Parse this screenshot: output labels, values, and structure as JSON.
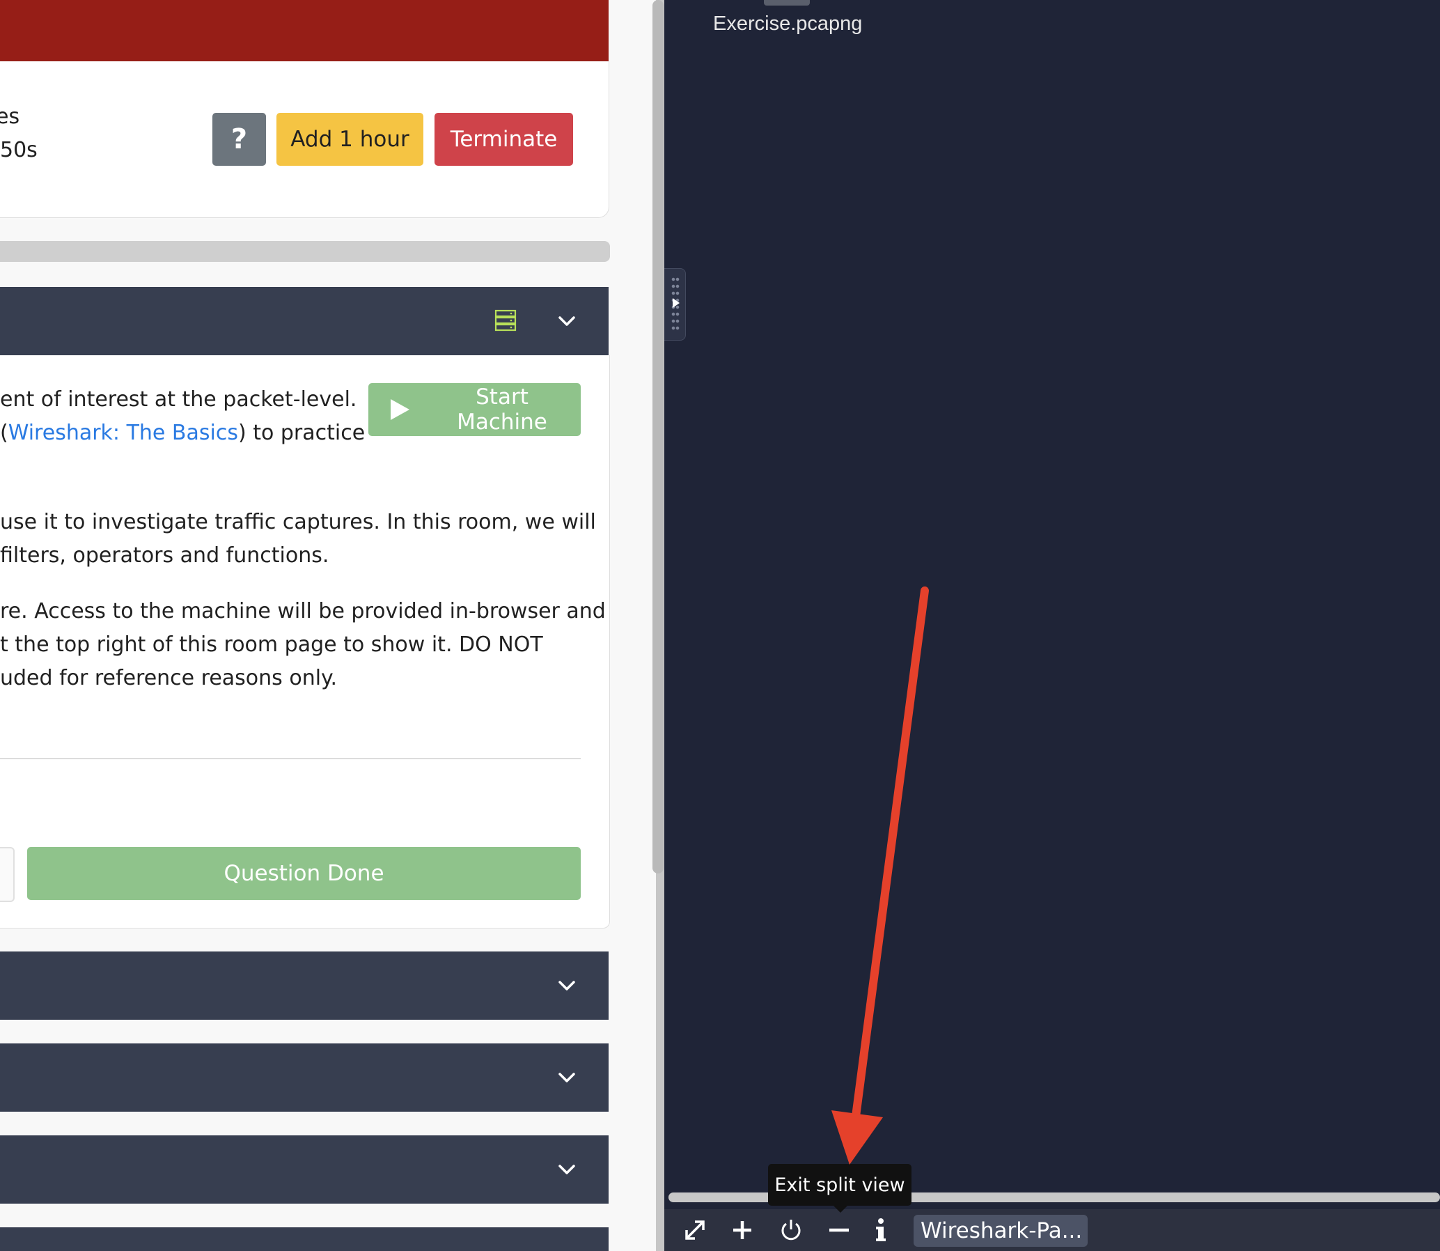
{
  "machine_panel": {
    "timer_line_1": "es",
    "timer_line_2": "50s",
    "help_label": "?",
    "add_hour_label": "Add 1 hour",
    "terminate_label": "Terminate"
  },
  "task": {
    "start_machine_label": "Start Machine",
    "lines": [
      {
        "before": "ent of interest at the packet-level.",
        "link": "",
        "after": ""
      },
      {
        "before": "(",
        "link": "Wireshark: The Basics",
        "after": ") to practice"
      },
      {
        "before": "use it to investigate traffic captures. In this room, we will",
        "link": "",
        "after": ""
      },
      {
        "before": "filters, operators and functions.",
        "link": "",
        "after": ""
      },
      {
        "before": "re. Access to the machine will be provided in-browser and",
        "link": "",
        "after": ""
      },
      {
        "before": "t the top right of this room page to show it. DO NOT",
        "link": "",
        "after": ""
      },
      {
        "before": "uded for reference reasons only.",
        "link": "",
        "after": ""
      }
    ],
    "question_done_label": "Question Done"
  },
  "vm": {
    "file_name": "Exercise.pcapng",
    "tooltip": "Exit split view",
    "taskbar_window": "Wireshark-Pa..."
  },
  "taskbar_icons": [
    "fullscreen-icon",
    "plus-icon",
    "power-icon",
    "minus-icon",
    "info-icon"
  ],
  "colors": {
    "banner_red": "#961e17",
    "task_header": "#373e50",
    "success_green": "#8fc38b",
    "warning_yellow": "#f5c443",
    "danger_red": "#cf434a",
    "vm_background": "#1f2437",
    "link_blue": "#2a7ae2",
    "annotation_arrow": "#e5412b"
  }
}
